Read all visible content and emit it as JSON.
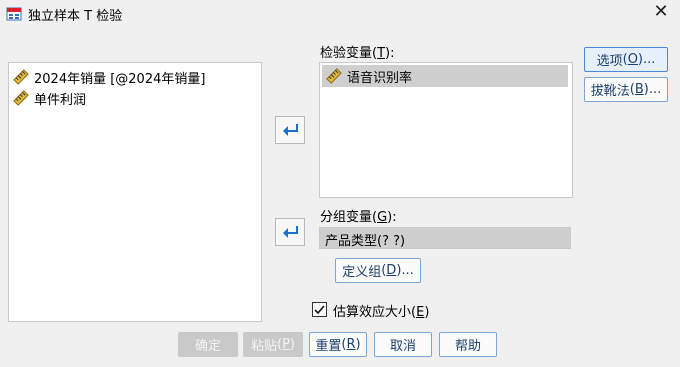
{
  "window": {
    "title": "独立样本 T 检验"
  },
  "source_list": {
    "items": [
      {
        "label": "2024年销量 [@2024年销量]"
      },
      {
        "label": "单件利润"
      }
    ]
  },
  "test_variables": {
    "label": "检验变量",
    "mnemonic": "T",
    "items": [
      {
        "label": "语音识别率"
      }
    ]
  },
  "grouping_variable": {
    "label": "分组变量",
    "mnemonic": "G",
    "value": "产品类型(? ?)"
  },
  "define_groups_button": {
    "label": "定义组",
    "mnemonic": "D"
  },
  "side_buttons": {
    "options": {
      "label": "选项",
      "mnemonic": "O"
    },
    "bootstrap": {
      "label": "拔靴法",
      "mnemonic": "B"
    }
  },
  "estimate_effect": {
    "label": "估算效应大小",
    "mnemonic": "E",
    "checked": true
  },
  "footer": {
    "ok": "确定",
    "paste": {
      "label": "粘贴",
      "mnemonic": "P"
    },
    "reset": {
      "label": "重置",
      "mnemonic": "R"
    },
    "cancel": "取消",
    "help": "帮助"
  },
  "colors": {
    "accent": "#1a6fd1",
    "ruler": "#c8a020"
  },
  "icons": {
    "app": "spss-dialog-icon",
    "variable": "ruler-scale-icon",
    "move": "arrow-move-icon",
    "close": "close-icon"
  }
}
